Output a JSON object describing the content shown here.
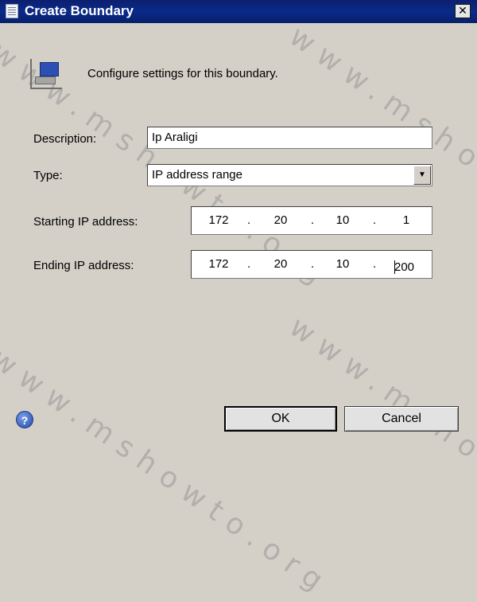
{
  "window": {
    "title": "Create Boundary",
    "close_label": "✕"
  },
  "header": {
    "text": "Configure settings for this boundary.",
    "icon": "boundary-network-icon"
  },
  "form": {
    "description": {
      "label": "Description:",
      "value": "Ip Araligi"
    },
    "type": {
      "label": "Type:",
      "value": "IP address range",
      "arrow": "▼"
    },
    "start_ip": {
      "label": "Starting IP address:",
      "octets": [
        "172",
        "20",
        "10",
        "1"
      ]
    },
    "end_ip": {
      "label": "Ending IP address:",
      "octets": [
        "172",
        "20",
        "10",
        "200"
      ]
    },
    "separator": "."
  },
  "buttons": {
    "ok": "OK",
    "cancel": "Cancel",
    "help": "?"
  },
  "watermark": {
    "text": "www.mshowto.org"
  }
}
